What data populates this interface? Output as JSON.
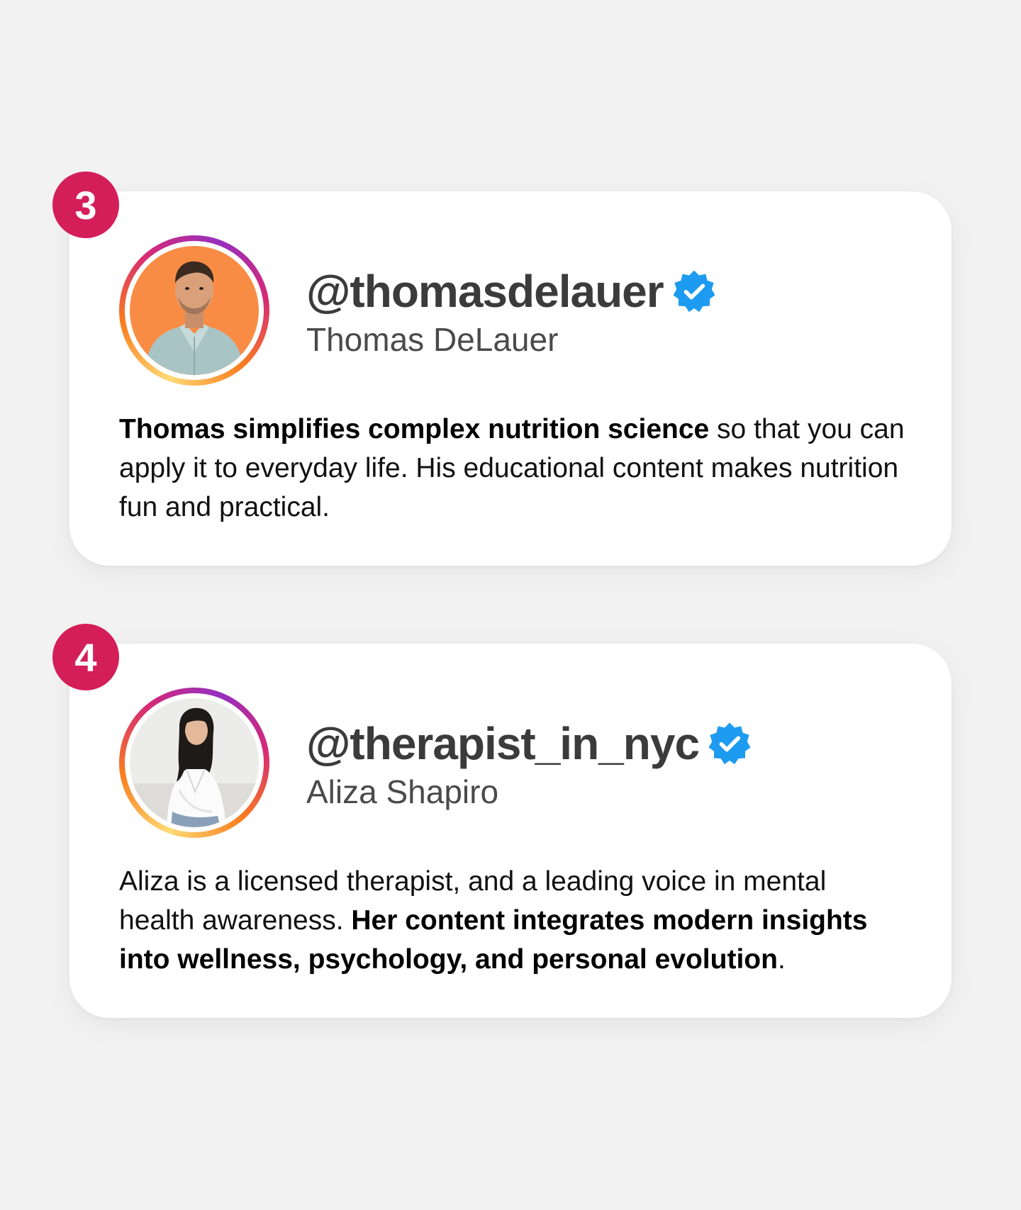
{
  "cards": [
    {
      "number": "3",
      "handle": "@thomasdelauer",
      "display_name": "Thomas DeLauer",
      "bio_bold_1": "Thomas simplifies complex nutrition science",
      "bio_text_1": " so that you can apply it to everyday life. His educational content makes nutrition fun and practical.",
      "avatar_icon": "man-portrait-orange-background"
    },
    {
      "number": "4",
      "handle": "@therapist_in_nyc",
      "display_name": "Aliza Shapiro",
      "bio_text_1": "Aliza is a licensed therapist, and a leading voice in mental health awareness. ",
      "bio_bold_1": "Her content integrates modern insights into wellness, psychology, and personal evolution",
      "bio_text_2": ".",
      "avatar_icon": "woman-portrait-white-background"
    }
  ],
  "colors": {
    "background": "#f2f2f2",
    "card": "#ffffff",
    "badge": "#d41e5a",
    "verified": "#1d9bf0",
    "handle": "#3b3b3b",
    "display_name": "#4a4a4a"
  }
}
